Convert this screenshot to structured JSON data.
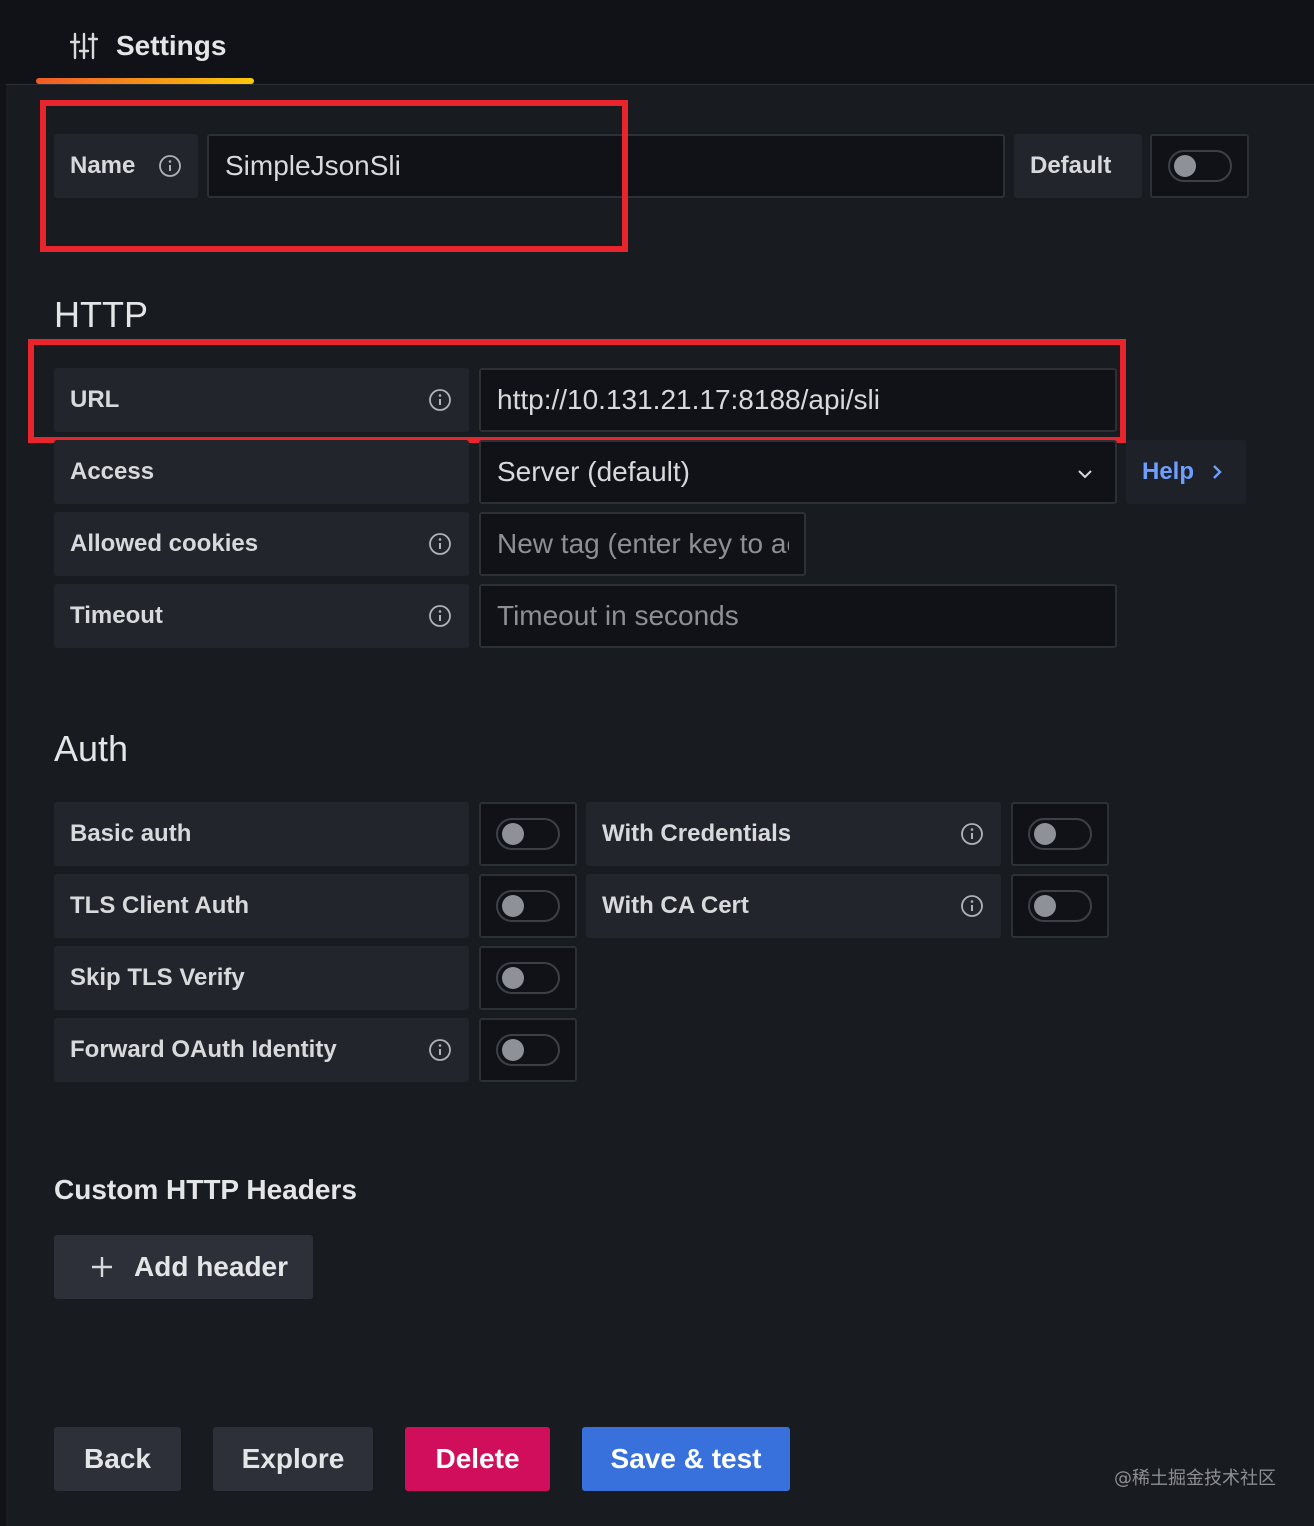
{
  "tabs": [
    {
      "label": "Settings",
      "icon": "sliders-icon",
      "active": true
    }
  ],
  "basic": {
    "name_label": "Name",
    "name_value": "SimpleJsonSli",
    "default_label": "Default",
    "default_on": false
  },
  "http": {
    "title": "HTTP",
    "url_label": "URL",
    "url_value": "http://10.131.21.17:8188/api/sli",
    "access_label": "Access",
    "access_value": "Server (default)",
    "help_label": "Help",
    "cookies_label": "Allowed cookies",
    "cookies_placeholder": "New tag (enter key to ac",
    "timeout_label": "Timeout",
    "timeout_placeholder": "Timeout in seconds"
  },
  "auth": {
    "title": "Auth",
    "items": [
      {
        "label": "Basic auth",
        "on": false
      },
      {
        "label": "TLS Client Auth",
        "on": false
      },
      {
        "label": "Skip TLS Verify",
        "on": false
      },
      {
        "label": "Forward OAuth Identity",
        "on": false
      },
      {
        "label": "With Credentials",
        "on": false
      },
      {
        "label": "With CA Cert",
        "on": false
      }
    ]
  },
  "headers": {
    "title": "Custom HTTP Headers",
    "add_label": "Add header"
  },
  "actions": {
    "back": "Back",
    "explore": "Explore",
    "delete": "Delete",
    "save": "Save & test"
  },
  "colors": {
    "highlight": "#e8242c",
    "primary": "#3871dc",
    "danger": "#d10e5c",
    "link": "#6e9fff"
  },
  "watermark": "@稀土掘金技术社区"
}
